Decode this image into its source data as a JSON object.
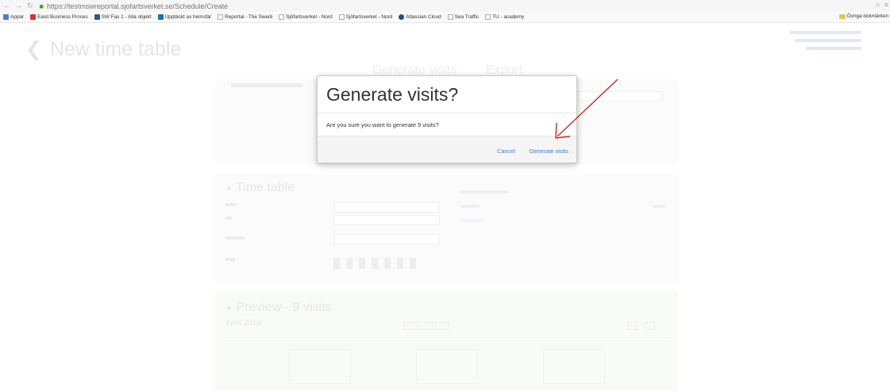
{
  "browser": {
    "url": "https://testmswreportal.sjofartsverket.se/Schedule/Create",
    "bookmarks": [
      {
        "label": "Appar",
        "color": "#4a7fd6"
      },
      {
        "label": "Easit Business Proces",
        "color": "#d9342b"
      },
      {
        "label": "SW Fas 1 - Alla objekt",
        "color": "#2b579a"
      },
      {
        "label": "Upptäckt av hemsfär",
        "color": "#1f6fb2"
      },
      {
        "label": "Reportal - The Swedi",
        "color": "#bbbbbb"
      },
      {
        "label": "Sjöfartsverket - Nord",
        "color": "#bbbbbb"
      },
      {
        "label": "Sjöfartsverket - Nord",
        "color": "#bbbbbb"
      },
      {
        "label": "Atlassian Cloud",
        "color": "#205081"
      },
      {
        "label": "Sea Traffic",
        "color": "#bbbbbb"
      },
      {
        "label": "TU - academy",
        "color": "#bbbbbb"
      }
    ],
    "other_bookmarks": "Övriga bokmärken"
  },
  "page": {
    "title": "New time table",
    "back_icon": "chevron-left-icon",
    "tabs": [
      "Generate visits",
      "Export"
    ],
    "time_table_heading": "Time table",
    "preview_heading": "Preview - 9 visits",
    "month": "April 2016"
  },
  "modal": {
    "title": "Generate visits?",
    "body": "Are you sure you want to generate 9 visits?",
    "cancel_label": "Cancel",
    "confirm_label": "Generate visits",
    "link_color": "#3a7bd5"
  },
  "annotation": {
    "arrow_color": "#c0392b"
  }
}
